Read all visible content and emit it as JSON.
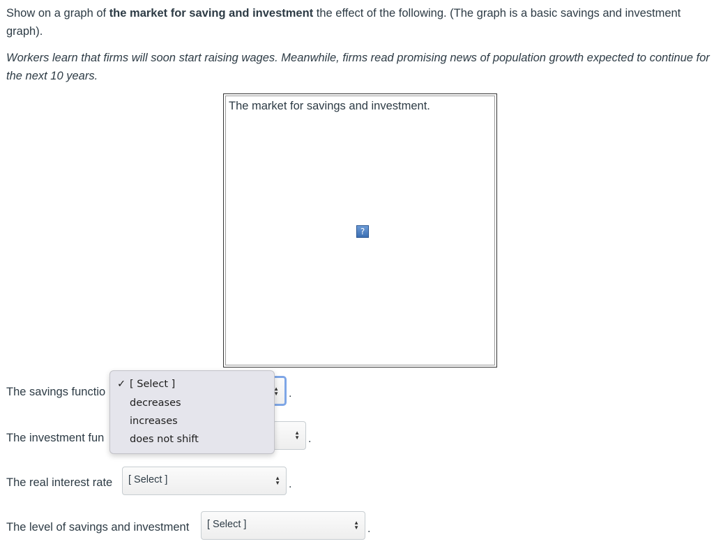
{
  "prompt": {
    "before": "Show on a graph of ",
    "bold": "the market for saving and investment",
    "after": " the effect of the following. (The graph is a basic savings and investment graph)."
  },
  "scenario": "Workers learn that firms will soon start raising wages. Meanwhile, firms read promising news of population growth expected to continue for the next 10 years.",
  "graph": {
    "caption": "The market for savings and investment.",
    "broken_image_glyph": "?",
    "icon": "broken-image-icon"
  },
  "questions": [
    {
      "label": "The savings functio",
      "value": "",
      "suffix": "."
    },
    {
      "label": "The investment fun",
      "value": "",
      "suffix": "."
    },
    {
      "label": "The real interest rate",
      "value": "[ Select ]",
      "suffix": "."
    },
    {
      "label": "The level of savings and investment",
      "value": "[ Select ]",
      "suffix": "."
    }
  ],
  "dropdown": {
    "check_glyph": "✓",
    "options": [
      "[ Select ]",
      "decreases",
      "increases",
      "does not shift"
    ],
    "selected": "[ Select ]"
  },
  "colors": {
    "text": "#2d3b45",
    "focus_ring": "#7ea6e6",
    "menu_bg": "#e5e5ec",
    "icon_blue": "#3b6fb3"
  }
}
